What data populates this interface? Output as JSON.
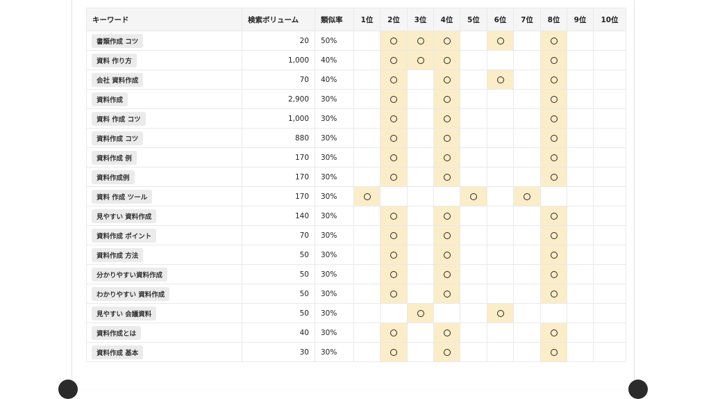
{
  "table": {
    "headers": {
      "keyword": "キーワード",
      "volume": "検索ボリューム",
      "similarity": "類似率",
      "ranks": [
        "1位",
        "2位",
        "3位",
        "4位",
        "5位",
        "6位",
        "7位",
        "8位",
        "9位",
        "10位"
      ]
    },
    "mark_glyph": "○",
    "highlight_color": "#fbedc8",
    "rows": [
      {
        "keyword": "書類作成 コツ",
        "volume": "20",
        "similarity": "50%",
        "hits": [
          2,
          3,
          4,
          6,
          8
        ],
        "hl": [
          2,
          3,
          4,
          6,
          8
        ]
      },
      {
        "keyword": "資料 作り方",
        "volume": "1,000",
        "similarity": "40%",
        "hits": [
          2,
          3,
          4,
          8
        ],
        "hl": [
          2,
          3,
          4,
          8
        ]
      },
      {
        "keyword": "会社 資料作成",
        "volume": "70",
        "similarity": "40%",
        "hits": [
          2,
          4,
          6,
          8
        ],
        "hl": [
          2,
          4,
          6,
          8
        ]
      },
      {
        "keyword": "資料作成",
        "volume": "2,900",
        "similarity": "30%",
        "hits": [
          2,
          4,
          8
        ],
        "hl": [
          2,
          4,
          8
        ]
      },
      {
        "keyword": "資料 作成 コツ",
        "volume": "1,000",
        "similarity": "30%",
        "hits": [
          2,
          4,
          8
        ],
        "hl": [
          2,
          4,
          8
        ]
      },
      {
        "keyword": "資料作成 コツ",
        "volume": "880",
        "similarity": "30%",
        "hits": [
          2,
          4,
          8
        ],
        "hl": [
          2,
          4,
          8
        ]
      },
      {
        "keyword": "資料作成 例",
        "volume": "170",
        "similarity": "30%",
        "hits": [
          2,
          4,
          8
        ],
        "hl": [
          2,
          4,
          8
        ]
      },
      {
        "keyword": "資料作成例",
        "volume": "170",
        "similarity": "30%",
        "hits": [
          2,
          4,
          8
        ],
        "hl": [
          2,
          4,
          8
        ]
      },
      {
        "keyword": "資料 作成 ツール",
        "volume": "170",
        "similarity": "30%",
        "hits": [
          1,
          5,
          7
        ],
        "hl": [
          1,
          5,
          7
        ]
      },
      {
        "keyword": "見やすい 資料作成",
        "volume": "140",
        "similarity": "30%",
        "hits": [
          2,
          4,
          8
        ],
        "hl": [
          2,
          4,
          8
        ]
      },
      {
        "keyword": "資料作成 ポイント",
        "volume": "70",
        "similarity": "30%",
        "hits": [
          2,
          4,
          8
        ],
        "hl": [
          2,
          4,
          8
        ]
      },
      {
        "keyword": "資料作成 方法",
        "volume": "50",
        "similarity": "30%",
        "hits": [
          2,
          4,
          8
        ],
        "hl": [
          2,
          4,
          8
        ]
      },
      {
        "keyword": "分かりやすい資料作成",
        "volume": "50",
        "similarity": "30%",
        "hits": [
          2,
          4,
          8
        ],
        "hl": [
          2,
          4,
          8
        ]
      },
      {
        "keyword": "わかりやすい 資料作成",
        "volume": "50",
        "similarity": "30%",
        "hits": [
          2,
          4,
          8
        ],
        "hl": [
          2,
          4,
          8
        ]
      },
      {
        "keyword": "見やすい 会議資料",
        "volume": "50",
        "similarity": "30%",
        "hits": [
          3,
          6
        ],
        "hl": [
          3,
          6
        ]
      },
      {
        "keyword": "資料作成とは",
        "volume": "40",
        "similarity": "30%",
        "hits": [
          2,
          4,
          8
        ],
        "hl": [
          2,
          4,
          8
        ]
      },
      {
        "keyword": "資料作成 基本",
        "volume": "30",
        "similarity": "30%",
        "hits": [
          2,
          4,
          8
        ],
        "hl": [
          2,
          4,
          8
        ]
      }
    ]
  }
}
